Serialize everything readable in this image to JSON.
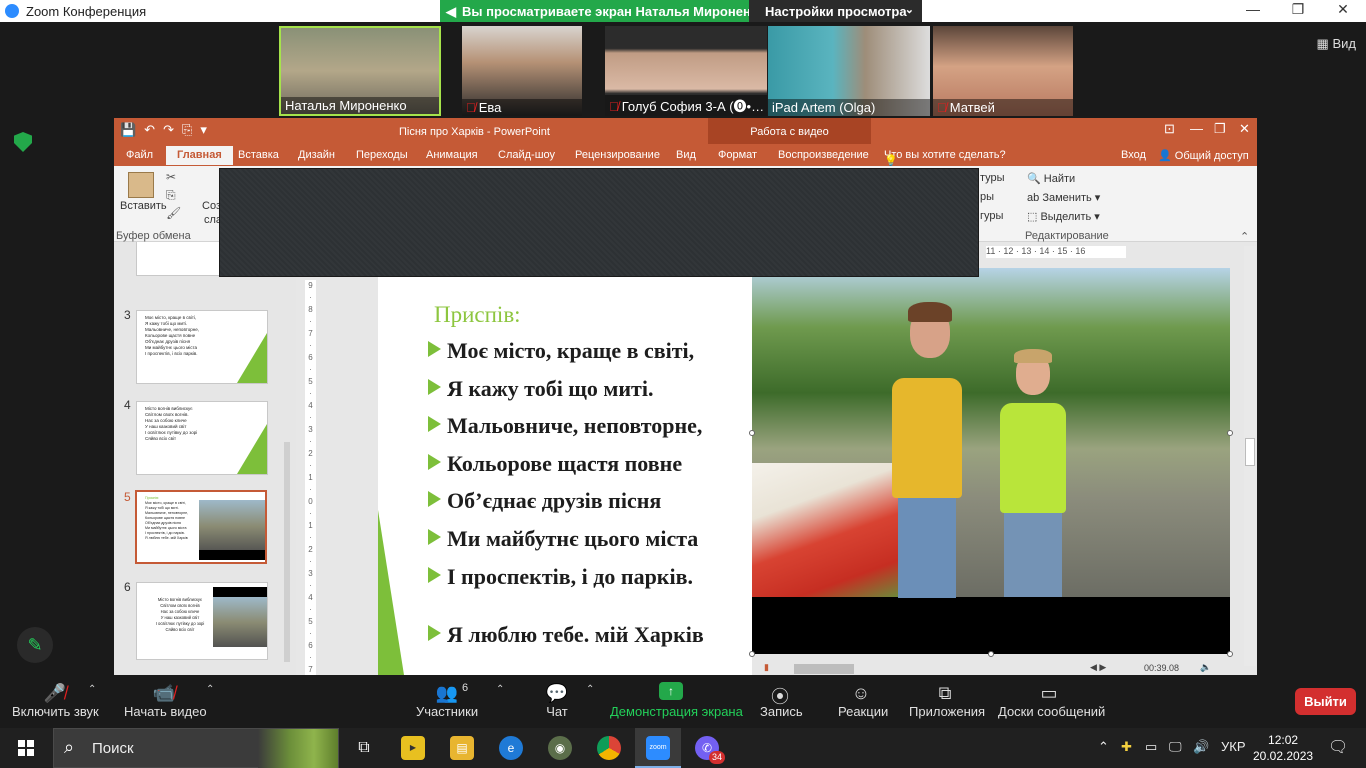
{
  "zoom": {
    "title": "Zoom Конференция",
    "share_banner": "Вы просматриваете экран Наталья Мироненко",
    "view_options": "Настройки просмотра",
    "view_button": "Вид",
    "participants": [
      {
        "name": "Наталья Мироненко",
        "muted": false
      },
      {
        "name": "Ева",
        "muted": true
      },
      {
        "name": "Голуб София 3-А (⓿•…",
        "muted": true
      },
      {
        "name": "iPad Artem (Olga)",
        "muted": false
      },
      {
        "name": "Матвей",
        "muted": true
      }
    ],
    "toolbar": {
      "unmute": "Включить звук",
      "start_video": "Начать видео",
      "participants": "Участники",
      "participants_count": "6",
      "chat": "Чат",
      "share": "Демонстрация экрана",
      "record": "Запись",
      "reactions": "Реакции",
      "apps": "Приложения",
      "whiteboards": "Доски сообщений",
      "leave": "Выйти"
    }
  },
  "ppt": {
    "doc_title": "Пісня про Харків - PowerPoint",
    "context_tab": "Работа с видео",
    "tabs": [
      "Файл",
      "Главная",
      "Вставка",
      "Дизайн",
      "Переходы",
      "Анимация",
      "Слайд-шоу",
      "Рецензирование",
      "Вид",
      "Формат",
      "Воспроизведение"
    ],
    "tell_me": "Что вы хотите сделать?",
    "sign_in": "Вход",
    "share": "Общий доступ",
    "ribbon": {
      "paste": "Вставить",
      "create_partial": "Соз",
      "slides_partial": "сла",
      "clipboard_group": "Буфер обмена",
      "fragments": [
        "туры",
        "ры",
        "гуры"
      ],
      "find": "Найти",
      "replace": "Заменить",
      "select": "Выделить",
      "editing_group": "Редактирование"
    },
    "ruler_ticks": "11 · 12 · 13 · 14 · 15 · 16",
    "thumbnails": [
      {
        "num": "3",
        "lines": [
          "Моє місто, краще в світі,",
          "Я кажу тобі що миті.",
          "Мальовниче, неповторне,",
          "Кольорове щастя повне",
          "Об'єднає друзів пісня",
          "Ми майбутнє цього міста",
          "І проспектів, і всіх парків."
        ]
      },
      {
        "num": "4",
        "lines": [
          "Місто вогнів виблискує",
          "Світлом своїх вогнів.",
          "Нас за собою кличе",
          "У наш казковий світ",
          "І освітлює путівку до зорі",
          "Сяйво всіх світ"
        ]
      },
      {
        "num": "5",
        "lines": [
          "Приспів:",
          "Моє місто, краще в світі,",
          "Я кажу тобі що миті.",
          "Мальовниче, неповторне,",
          "Кольорове щастя повне",
          "Об'єднає друзів пісня",
          "Ми майбутнє цього міста",
          "І проспектів, і до парків.",
          "Я люблю тебе. мій Харків"
        ]
      },
      {
        "num": "6",
        "lines": [
          "Місто вогнів виблискує",
          "Світлом своїх вогнів",
          "Нас за собою кличе",
          "У наш казковий світ",
          "І освітлює путівку до зорі",
          "Сяйво всіх світ"
        ]
      }
    ],
    "slide": {
      "chorus_label": "Приспів:",
      "lines": [
        "Моє місто, краще в світі,",
        "Я кажу тобі що миті.",
        "Мальовниче, неповторне,",
        "Кольорове щастя повне",
        "Об’єднає друзів пісня",
        "Ми майбутнє цього міста",
        "І проспектів, і до парків.",
        "Я люблю тебе. мій Харків"
      ]
    },
    "video_time": "00:39.08"
  },
  "taskbar": {
    "search_placeholder": "Поиск",
    "lang": "УКР",
    "time": "12:02",
    "date": "20.02.2023",
    "viber_badge": "34"
  },
  "colors": {
    "ppt_accent": "#c55a36",
    "slide_green": "#7dbf3a",
    "zoom_green": "#23a84a",
    "leave_red": "#d32f2f"
  }
}
